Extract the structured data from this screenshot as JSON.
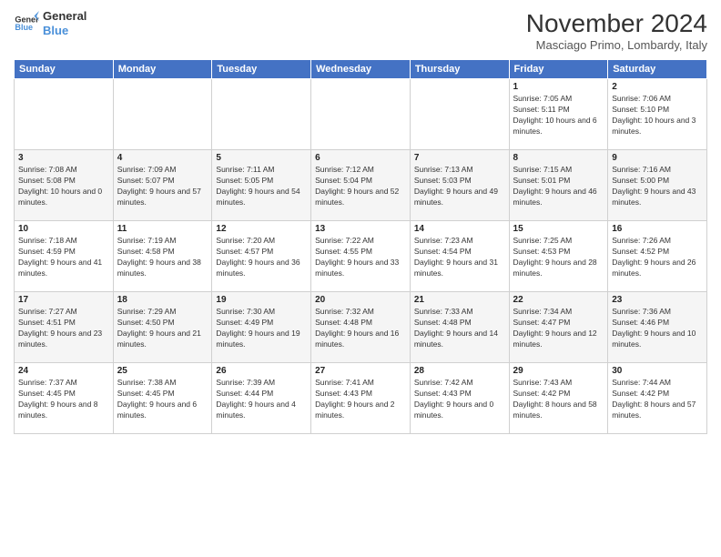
{
  "header": {
    "logo_line1": "General",
    "logo_line2": "Blue",
    "month_title": "November 2024",
    "location": "Masciago Primo, Lombardy, Italy"
  },
  "days_of_week": [
    "Sunday",
    "Monday",
    "Tuesday",
    "Wednesday",
    "Thursday",
    "Friday",
    "Saturday"
  ],
  "weeks": [
    [
      {
        "day": "",
        "info": ""
      },
      {
        "day": "",
        "info": ""
      },
      {
        "day": "",
        "info": ""
      },
      {
        "day": "",
        "info": ""
      },
      {
        "day": "",
        "info": ""
      },
      {
        "day": "1",
        "info": "Sunrise: 7:05 AM\nSunset: 5:11 PM\nDaylight: 10 hours and 6 minutes."
      },
      {
        "day": "2",
        "info": "Sunrise: 7:06 AM\nSunset: 5:10 PM\nDaylight: 10 hours and 3 minutes."
      }
    ],
    [
      {
        "day": "3",
        "info": "Sunrise: 7:08 AM\nSunset: 5:08 PM\nDaylight: 10 hours and 0 minutes."
      },
      {
        "day": "4",
        "info": "Sunrise: 7:09 AM\nSunset: 5:07 PM\nDaylight: 9 hours and 57 minutes."
      },
      {
        "day": "5",
        "info": "Sunrise: 7:11 AM\nSunset: 5:05 PM\nDaylight: 9 hours and 54 minutes."
      },
      {
        "day": "6",
        "info": "Sunrise: 7:12 AM\nSunset: 5:04 PM\nDaylight: 9 hours and 52 minutes."
      },
      {
        "day": "7",
        "info": "Sunrise: 7:13 AM\nSunset: 5:03 PM\nDaylight: 9 hours and 49 minutes."
      },
      {
        "day": "8",
        "info": "Sunrise: 7:15 AM\nSunset: 5:01 PM\nDaylight: 9 hours and 46 minutes."
      },
      {
        "day": "9",
        "info": "Sunrise: 7:16 AM\nSunset: 5:00 PM\nDaylight: 9 hours and 43 minutes."
      }
    ],
    [
      {
        "day": "10",
        "info": "Sunrise: 7:18 AM\nSunset: 4:59 PM\nDaylight: 9 hours and 41 minutes."
      },
      {
        "day": "11",
        "info": "Sunrise: 7:19 AM\nSunset: 4:58 PM\nDaylight: 9 hours and 38 minutes."
      },
      {
        "day": "12",
        "info": "Sunrise: 7:20 AM\nSunset: 4:57 PM\nDaylight: 9 hours and 36 minutes."
      },
      {
        "day": "13",
        "info": "Sunrise: 7:22 AM\nSunset: 4:55 PM\nDaylight: 9 hours and 33 minutes."
      },
      {
        "day": "14",
        "info": "Sunrise: 7:23 AM\nSunset: 4:54 PM\nDaylight: 9 hours and 31 minutes."
      },
      {
        "day": "15",
        "info": "Sunrise: 7:25 AM\nSunset: 4:53 PM\nDaylight: 9 hours and 28 minutes."
      },
      {
        "day": "16",
        "info": "Sunrise: 7:26 AM\nSunset: 4:52 PM\nDaylight: 9 hours and 26 minutes."
      }
    ],
    [
      {
        "day": "17",
        "info": "Sunrise: 7:27 AM\nSunset: 4:51 PM\nDaylight: 9 hours and 23 minutes."
      },
      {
        "day": "18",
        "info": "Sunrise: 7:29 AM\nSunset: 4:50 PM\nDaylight: 9 hours and 21 minutes."
      },
      {
        "day": "19",
        "info": "Sunrise: 7:30 AM\nSunset: 4:49 PM\nDaylight: 9 hours and 19 minutes."
      },
      {
        "day": "20",
        "info": "Sunrise: 7:32 AM\nSunset: 4:48 PM\nDaylight: 9 hours and 16 minutes."
      },
      {
        "day": "21",
        "info": "Sunrise: 7:33 AM\nSunset: 4:48 PM\nDaylight: 9 hours and 14 minutes."
      },
      {
        "day": "22",
        "info": "Sunrise: 7:34 AM\nSunset: 4:47 PM\nDaylight: 9 hours and 12 minutes."
      },
      {
        "day": "23",
        "info": "Sunrise: 7:36 AM\nSunset: 4:46 PM\nDaylight: 9 hours and 10 minutes."
      }
    ],
    [
      {
        "day": "24",
        "info": "Sunrise: 7:37 AM\nSunset: 4:45 PM\nDaylight: 9 hours and 8 minutes."
      },
      {
        "day": "25",
        "info": "Sunrise: 7:38 AM\nSunset: 4:45 PM\nDaylight: 9 hours and 6 minutes."
      },
      {
        "day": "26",
        "info": "Sunrise: 7:39 AM\nSunset: 4:44 PM\nDaylight: 9 hours and 4 minutes."
      },
      {
        "day": "27",
        "info": "Sunrise: 7:41 AM\nSunset: 4:43 PM\nDaylight: 9 hours and 2 minutes."
      },
      {
        "day": "28",
        "info": "Sunrise: 7:42 AM\nSunset: 4:43 PM\nDaylight: 9 hours and 0 minutes."
      },
      {
        "day": "29",
        "info": "Sunrise: 7:43 AM\nSunset: 4:42 PM\nDaylight: 8 hours and 58 minutes."
      },
      {
        "day": "30",
        "info": "Sunrise: 7:44 AM\nSunset: 4:42 PM\nDaylight: 8 hours and 57 minutes."
      }
    ]
  ]
}
